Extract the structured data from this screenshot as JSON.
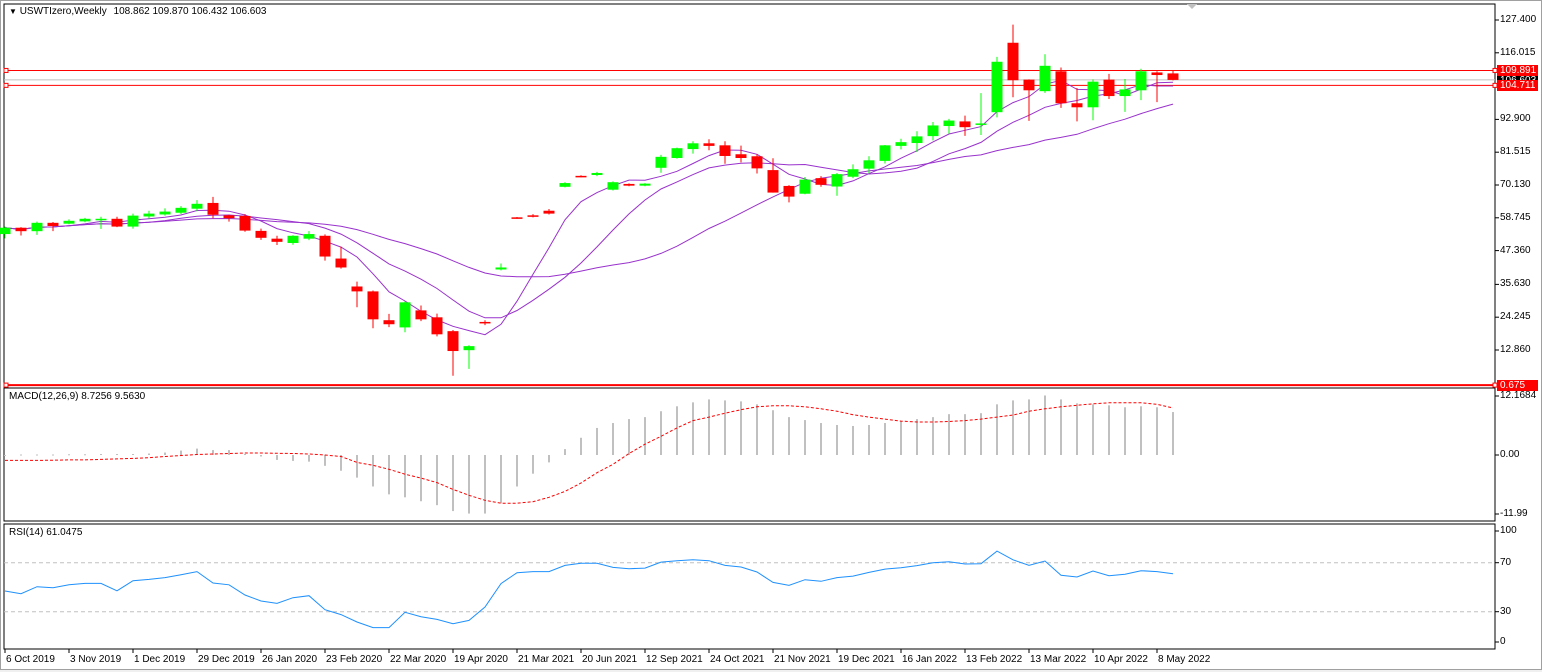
{
  "header": {
    "symbol": "USWTIzero,Weekly",
    "ohlc": "108.862 109.870 106.432 106.603"
  },
  "price_axis": {
    "ticks": [
      "127.400",
      "116.015",
      "92.900",
      "81.515",
      "70.130",
      "58.745",
      "47.360",
      "35.630",
      "24.245",
      "12.860"
    ]
  },
  "levels": [
    {
      "label": "109.891",
      "value": 109.891,
      "color": "#ff0000",
      "kind": "hline"
    },
    {
      "label": "106.603",
      "value": 106.603,
      "color": "#000000",
      "kind": "bid"
    },
    {
      "label": "104.711",
      "value": 104.711,
      "color": "#ff0000",
      "kind": "hline"
    },
    {
      "label": "0.675",
      "value": 0.675,
      "color": "#ff0000",
      "kind": "hline"
    }
  ],
  "colors": {
    "bull": "#00ff00",
    "bear": "#ff0000",
    "ma": "#9932cc",
    "macd_hist": "#c0c0c0",
    "macd_signal": "#ff0000",
    "rsi": "#1e90ff"
  },
  "macd": {
    "title": "MACD(12,26,9) 8.7256 9.5630",
    "axis": [
      "12.1684",
      "0.00",
      "-11.99"
    ],
    "max": 12.1684,
    "min": -11.99,
    "hist": [
      0,
      0.1,
      0.1,
      0.1,
      0.15,
      0.15,
      0.2,
      0.2,
      0.2,
      0.3,
      0.5,
      0.9,
      1.3,
      1.0,
      1.0,
      0.2,
      -0.3,
      -1.0,
      -1.2,
      -1.35,
      -2.2,
      -3.2,
      -4.6,
      -6.4,
      -8.0,
      -8.6,
      -9.4,
      -10.2,
      -11.4,
      -11.9,
      -11.9,
      -9.8,
      -6.4,
      -3.8,
      -1.5,
      1.2,
      3.5,
      5.5,
      6.5,
      7.3,
      7.7,
      8.9,
      9.9,
      10.7,
      11.3,
      11.1,
      10.9,
      10.3,
      9.1,
      7.7,
      7.1,
      6.5,
      6.1,
      5.9,
      6.1,
      6.5,
      6.9,
      7.3,
      7.7,
      8.3,
      8.3,
      8.5,
      10.3,
      11.1,
      11.3,
      12.1,
      11.3,
      10.5,
      10.3,
      10.1,
      9.7,
      9.9,
      9.7,
      8.73
    ],
    "signal": [
      -1.1,
      -1.1,
      -1.1,
      -1.05,
      -1.0,
      -1.0,
      -0.9,
      -0.8,
      -0.7,
      -0.55,
      -0.3,
      -0.1,
      0.1,
      0.2,
      0.3,
      0.4,
      0.4,
      0.35,
      0.3,
      0.2,
      0.0,
      -0.3,
      -1.5,
      -2.1,
      -2.9,
      -3.9,
      -4.7,
      -5.6,
      -7.0,
      -8.2,
      -9.2,
      -9.8,
      -9.8,
      -9.5,
      -8.6,
      -7.4,
      -5.7,
      -3.6,
      -1.9,
      0.3,
      2.2,
      3.8,
      5.5,
      7.0,
      7.7,
      8.5,
      9.2,
      9.8,
      10.0,
      10.0,
      9.8,
      9.4,
      8.9,
      8.2,
      7.7,
      7.3,
      6.9,
      6.7,
      6.7,
      6.8,
      7.0,
      7.3,
      7.7,
      8.1,
      8.9,
      9.4,
      9.8,
      10.1,
      10.4,
      10.6,
      10.6,
      10.6,
      10.3,
      9.56
    ]
  },
  "rsi": {
    "title": "RSI(14) 61.0475",
    "axis": [
      "100",
      "70",
      "30",
      "0"
    ],
    "levels": [
      70,
      30
    ],
    "values": [
      46.9,
      44.7,
      50.4,
      49.6,
      52.0,
      53.1,
      53.1,
      47.1,
      55.3,
      56.4,
      57.8,
      60.2,
      62.7,
      53.4,
      52.0,
      43.6,
      38.7,
      36.8,
      41.4,
      43.1,
      31.6,
      27.6,
      21.6,
      17.0,
      17.0,
      29.5,
      25.9,
      23.7,
      20.2,
      22.9,
      33.8,
      52.9,
      61.8,
      62.7,
      62.7,
      67.8,
      69.5,
      69.5,
      66.2,
      65.1,
      65.6,
      70.5,
      71.6,
      72.4,
      71.6,
      67.8,
      66.5,
      62.4,
      53.9,
      51.5,
      56.1,
      54.8,
      57.8,
      59.1,
      62.1,
      64.8,
      65.9,
      67.6,
      70.0,
      70.8,
      68.9,
      69.2,
      79.5,
      72.4,
      67.8,
      71.4,
      59.7,
      58.3,
      63.2,
      59.4,
      60.5,
      63.5,
      62.7,
      61.0475
    ]
  },
  "time_axis": {
    "labels": [
      "6 Oct 2019",
      "3 Nov 2019",
      "1 Dec 2019",
      "29 Dec 2019",
      "26 Jan 2020",
      "23 Feb 2020",
      "22 Mar 2020",
      "19 Apr 2020",
      "21 Mar 2021",
      "20 Jun 2021",
      "12 Sep 2021",
      "24 Oct 2021",
      "21 Nov 2021",
      "19 Dec 2021",
      "16 Jan 2022",
      "13 Feb 2022",
      "13 Mar 2022",
      "10 Apr 2022",
      "8 May 2022"
    ]
  },
  "chart_data": {
    "type": "candlestick",
    "title": "USWTIzero,Weekly",
    "ylim": [
      0.675,
      127.4
    ],
    "ohlc_order": [
      "open",
      "high",
      "low",
      "close"
    ],
    "ohlc": [
      [
        53.1,
        55.7,
        51.6,
        55.3
      ],
      [
        55.3,
        55.5,
        52.6,
        54.1
      ],
      [
        54.1,
        57.4,
        52.8,
        57.0
      ],
      [
        57.0,
        57.3,
        54.1,
        55.9
      ],
      [
        56.7,
        58.2,
        56.5,
        57.7
      ],
      [
        57.5,
        58.7,
        57.2,
        58.4
      ],
      [
        58.3,
        59.1,
        54.9,
        58.4
      ],
      [
        58.4,
        59.1,
        55.5,
        55.7
      ],
      [
        55.7,
        60.2,
        55.0,
        59.5
      ],
      [
        59.2,
        61.2,
        58.5,
        60.2
      ],
      [
        59.9,
        62.0,
        59.5,
        60.9
      ],
      [
        60.5,
        62.8,
        60.0,
        62.2
      ],
      [
        61.9,
        64.9,
        61.0,
        63.6
      ],
      [
        63.9,
        66.0,
        58.6,
        59.8
      ],
      [
        59.6,
        59.8,
        57.4,
        58.6
      ],
      [
        59.4,
        60.0,
        53.9,
        54.3
      ],
      [
        54.2,
        55.0,
        51.1,
        51.8
      ],
      [
        51.5,
        52.5,
        49.3,
        50.4
      ],
      [
        50.0,
        52.7,
        49.4,
        52.5
      ],
      [
        51.5,
        54.1,
        51.0,
        53.1
      ],
      [
        52.5,
        53.0,
        43.9,
        45.3
      ],
      [
        44.6,
        48.8,
        41.1,
        41.5
      ],
      [
        34.9,
        36.6,
        27.7,
        33.2
      ],
      [
        33.2,
        33.5,
        20.4,
        23.5
      ],
      [
        23.2,
        25.4,
        20.8,
        21.8
      ],
      [
        20.7,
        29.7,
        19.0,
        29.4
      ],
      [
        26.6,
        28.3,
        22.9,
        23.5
      ],
      [
        24.2,
        25.5,
        17.6,
        18.3
      ],
      [
        19.4,
        19.8,
        3.9,
        12.5
      ],
      [
        12.8,
        14.5,
        6.3,
        14.2
      ],
      [
        22.6,
        23.2,
        21.5,
        22.3
      ],
      [
        40.8,
        42.9,
        40.5,
        41.5
      ],
      [
        58.9,
        59.0,
        58.4,
        58.5
      ],
      [
        59.6,
        60.0,
        58.9,
        59.2
      ],
      [
        61.2,
        61.8,
        59.9,
        60.2
      ],
      [
        69.5,
        71.1,
        69.3,
        70.8
      ],
      [
        73.3,
        73.5,
        72.8,
        73.0
      ],
      [
        73.6,
        74.7,
        73.2,
        74.3
      ],
      [
        68.5,
        71.4,
        68.2,
        71.1
      ],
      [
        70.5,
        70.7,
        69.7,
        69.9
      ],
      [
        69.9,
        70.8,
        69.7,
        70.6
      ],
      [
        76.1,
        80.6,
        74.4,
        79.9
      ],
      [
        79.5,
        83.1,
        79.3,
        82.9
      ],
      [
        82.6,
        85.3,
        81.0,
        84.6
      ],
      [
        84.6,
        86.0,
        82.2,
        83.7
      ],
      [
        83.9,
        85.3,
        77.5,
        80.2
      ],
      [
        80.8,
        83.8,
        78.0,
        79.5
      ],
      [
        80.1,
        80.8,
        74.1,
        75.9
      ],
      [
        75.3,
        79.4,
        67.5,
        67.5
      ],
      [
        69.8,
        70.1,
        64.1,
        66.1
      ],
      [
        67.1,
        72.9,
        66.9,
        72.0
      ],
      [
        72.5,
        73.2,
        69.5,
        70.2
      ],
      [
        69.6,
        74.3,
        66.4,
        73.9
      ],
      [
        73.0,
        77.3,
        72.5,
        75.6
      ],
      [
        75.8,
        80.1,
        74.1,
        78.7
      ],
      [
        78.5,
        84.0,
        77.6,
        83.9
      ],
      [
        83.7,
        86.2,
        82.5,
        85.0
      ],
      [
        84.7,
        88.8,
        81.6,
        87.0
      ],
      [
        87.1,
        92.0,
        85.6,
        90.8
      ],
      [
        90.6,
        93.1,
        87.9,
        92.5
      ],
      [
        92.2,
        94.2,
        87.2,
        90.2
      ],
      [
        91.0,
        102.0,
        87.5,
        91.5
      ],
      [
        95.4,
        114.6,
        93.6,
        112.9
      ],
      [
        119.5,
        125.8,
        100.6,
        106.5
      ],
      [
        106.7,
        106.8,
        92.4,
        103.0
      ],
      [
        102.7,
        115.5,
        102.1,
        111.5
      ],
      [
        109.6,
        110.9,
        96.9,
        98.5
      ],
      [
        98.5,
        103.8,
        92.2,
        97.1
      ],
      [
        97.1,
        106.8,
        92.6,
        106.0
      ],
      [
        106.7,
        108.7,
        100.0,
        101.0
      ],
      [
        101.0,
        106.9,
        95.5,
        103.3
      ],
      [
        103.0,
        110.5,
        99.6,
        109.6
      ],
      [
        109.2,
        109.6,
        98.9,
        108.3
      ],
      [
        108.862,
        109.87,
        106.432,
        106.603
      ]
    ]
  }
}
